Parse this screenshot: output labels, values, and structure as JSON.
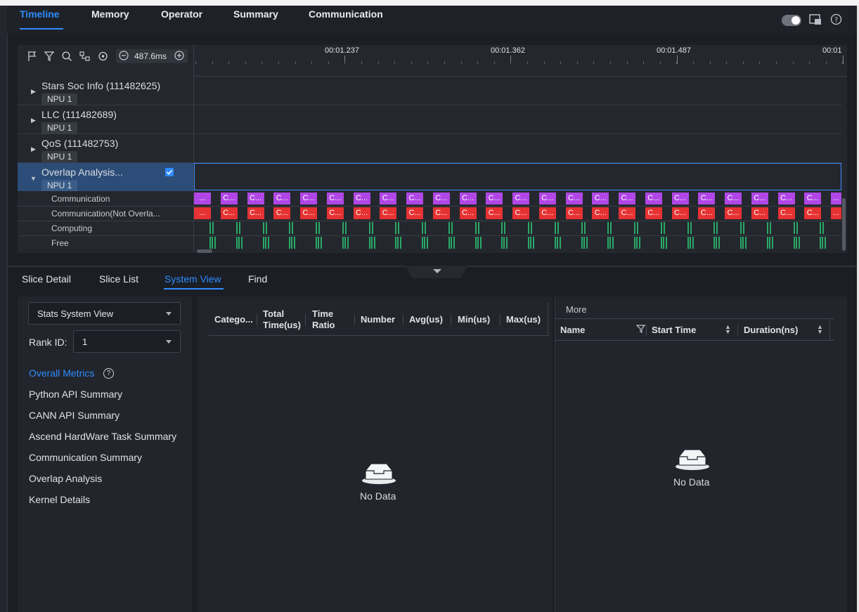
{
  "nav": {
    "tabs": [
      {
        "label": "Timeline"
      },
      {
        "label": "Memory"
      },
      {
        "label": "Operator"
      },
      {
        "label": "Summary"
      },
      {
        "label": "Communication"
      }
    ]
  },
  "timeline": {
    "zoom_label": "487.6ms",
    "ruler_labels": [
      "00:01.237",
      "00:01.362",
      "00:01.487",
      "00:01"
    ],
    "rows": [
      {
        "label": "Stars Soc Info (111482625)",
        "badge": "NPU 1"
      },
      {
        "label": "LLC (111482689)",
        "badge": "NPU 1"
      },
      {
        "label": "QoS (111482753)",
        "badge": "NPU 1"
      },
      {
        "label": "Overlap Analysis...",
        "badge": "NPU 1"
      }
    ],
    "sub_rows": [
      "Communication",
      "Communication(Not Overla...",
      "Computing",
      "Free"
    ],
    "segment_label": "C...",
    "segment_edge_label": "..."
  },
  "bottom": {
    "tabs": [
      "Slice Detail",
      "Slice List",
      "System View",
      "Find"
    ],
    "view_select": "Stats System View",
    "rank_label": "Rank ID:",
    "rank_value": "1",
    "metrics": [
      "Overall Metrics",
      "Python API Summary",
      "CANN API Summary",
      "Ascend HardWare Task Summary",
      "Communication Summary",
      "Overlap Analysis",
      "Kernel Details"
    ],
    "table_headers": [
      "Catego...",
      "Total Time(us)",
      "Time Ratio",
      "Number",
      "Avg(us)",
      "Min(us)",
      "Max(us)"
    ],
    "no_data": "No Data",
    "more_label": "More",
    "detail_headers": [
      "Name",
      "Start Time",
      "Duration(ns)"
    ]
  },
  "colors": {
    "accent": "#2e8cff",
    "comm": "#b146e6",
    "comm_not_overlapped": "#e63232",
    "compute": "#2aa867"
  }
}
